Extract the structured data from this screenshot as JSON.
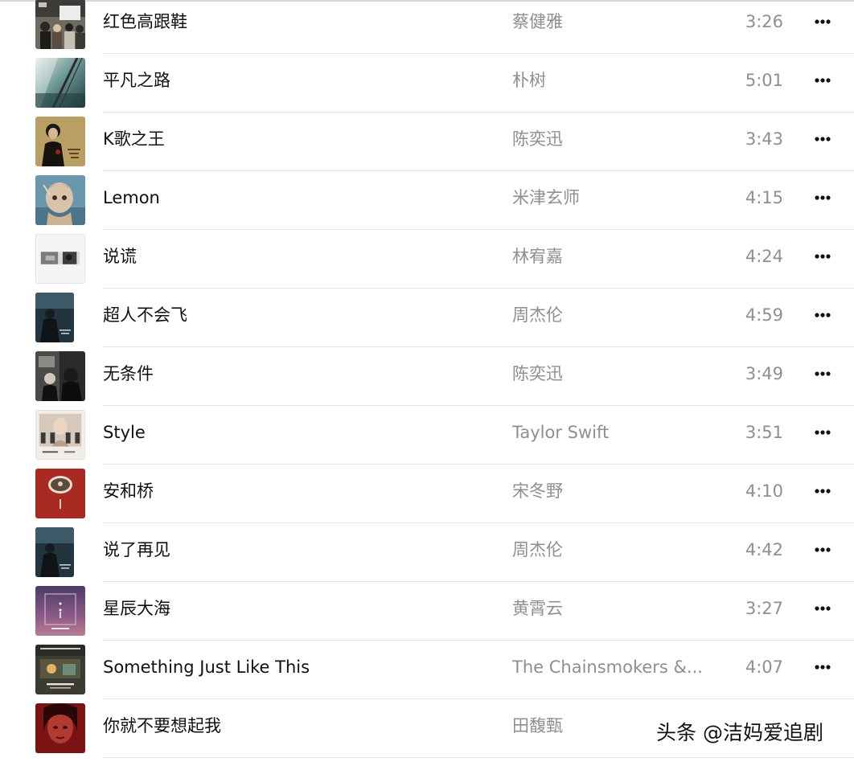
{
  "songs": [
    {
      "title": "红色高跟鞋",
      "artist": "蔡健雅",
      "duration": "3:26",
      "artwork_icon": "album-art-crowd-photo",
      "artwork_color": "#5b5b55"
    },
    {
      "title": "平凡之路",
      "artist": "朴树",
      "duration": "5:01",
      "artwork_icon": "album-art-light-rays",
      "artwork_color": "#3d6a6a"
    },
    {
      "title": "K歌之王",
      "artist": "陈奕迅",
      "duration": "3:43",
      "artwork_icon": "album-art-portrait-gold",
      "artwork_color": "#bda36a"
    },
    {
      "title": "Lemon",
      "artist": "米津玄师",
      "duration": "4:15",
      "artwork_icon": "album-art-painting-blue",
      "artwork_color": "#5f8ca4"
    },
    {
      "title": "说谎",
      "artist": "林宥嘉",
      "duration": "4:24",
      "artwork_icon": "album-art-white-portrait",
      "artwork_color": "#f3f3f3"
    },
    {
      "title": "超人不会飞",
      "artist": "周杰伦",
      "duration": "4:59",
      "artwork_icon": "album-art-dark-figure",
      "artwork_color": "#263a45"
    },
    {
      "title": "无条件",
      "artist": "陈奕迅",
      "duration": "3:49",
      "artwork_icon": "album-art-dark-photo",
      "artwork_color": "#2c2c2c"
    },
    {
      "title": "Style",
      "artist": "Taylor Swift",
      "duration": "3:51",
      "artwork_icon": "album-art-polaroid-1989",
      "artwork_color": "#e8e0d4"
    },
    {
      "title": "安和桥",
      "artist": "宋冬野",
      "duration": "4:10",
      "artwork_icon": "album-art-red-oval",
      "artwork_color": "#a82a22"
    },
    {
      "title": "说了再见",
      "artist": "周杰伦",
      "duration": "4:42",
      "artwork_icon": "album-art-dark-figure",
      "artwork_color": "#263a45"
    },
    {
      "title": "星辰大海",
      "artist": "黄霄云",
      "duration": "3:27",
      "artwork_icon": "album-art-purple-starry",
      "artwork_color": "#7a4f7a"
    },
    {
      "title": "Something Just Like This",
      "artist": "The Chainsmokers &...",
      "duration": "4:07",
      "artwork_icon": "album-art-memories-dark",
      "artwork_color": "#3a3a30"
    },
    {
      "title": "你就不要想起我",
      "artist": "田馥甄",
      "duration": "",
      "artwork_icon": "album-art-red-face",
      "artwork_color": "#8a1c1c"
    }
  ],
  "row_action_icon": "more-ellipsis-icon",
  "watermark": "头条 @洁妈爱追剧",
  "colors": {
    "title": "#101010",
    "secondary": "#8e8e93",
    "separator": "#e1e1e1"
  }
}
